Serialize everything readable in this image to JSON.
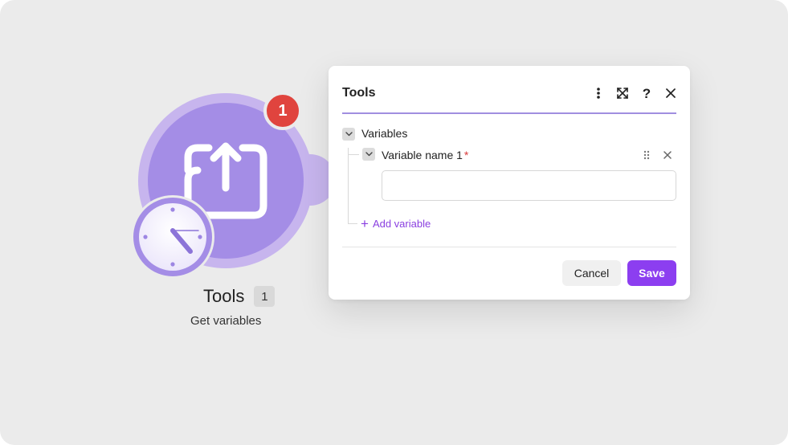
{
  "module": {
    "title": "Tools",
    "count": "1",
    "subtitle": "Get variables",
    "badge": "1",
    "icon": "upload-tray-icon",
    "trigger_icon": "clock-icon"
  },
  "dialog": {
    "title": "Tools",
    "header_icons": [
      "more-vertical-icon",
      "expand-icon",
      "help-icon",
      "close-icon"
    ],
    "help_label": "?",
    "section": {
      "label": "Variables",
      "item": {
        "label": "Variable name 1",
        "required_mark": "*",
        "value": "",
        "placeholder": ""
      },
      "add_label": "Add variable"
    },
    "cancel_label": "Cancel",
    "save_label": "Save"
  },
  "colors": {
    "canvas": "#ebebeb",
    "module": "#a48de6",
    "module_ring": "#c7b5ee",
    "badge": "#e0443e",
    "accent": "#8c3ef0",
    "header_rule": "#a08ee0"
  }
}
